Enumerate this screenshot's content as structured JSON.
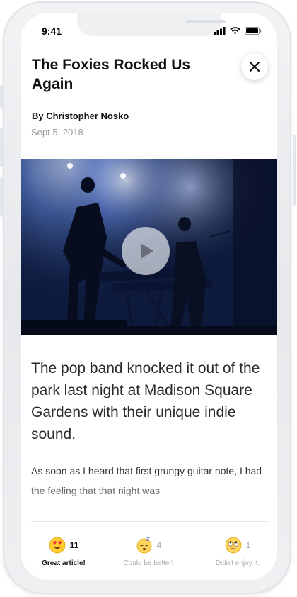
{
  "status_bar": {
    "time": "9:41"
  },
  "article": {
    "title": "The Foxies Rocked Us Again",
    "author": "By Christopher Nosko",
    "date": "Sept 5, 2018",
    "lead": "The pop band knocked it out of the park last night at Madison Square Gardens with their unique indie sound.",
    "body": "As soon as I heard that first grungy guitar note, I had the feeling that that night was"
  },
  "reactions": [
    {
      "count": "11",
      "label": "Great article!",
      "icon": "heart-eyes-emoji-icon",
      "selected": true
    },
    {
      "count": "4",
      "label": "Could be better!",
      "icon": "sleepy-emoji-icon",
      "selected": false
    },
    {
      "count": "1",
      "label": "Didn't enjoy it.",
      "icon": "rolling-eyes-emoji-icon",
      "selected": false
    }
  ],
  "colors": {
    "accent_text": "#111111",
    "muted_text": "#a8a8a8",
    "hero_blue": "#1c3a78"
  }
}
